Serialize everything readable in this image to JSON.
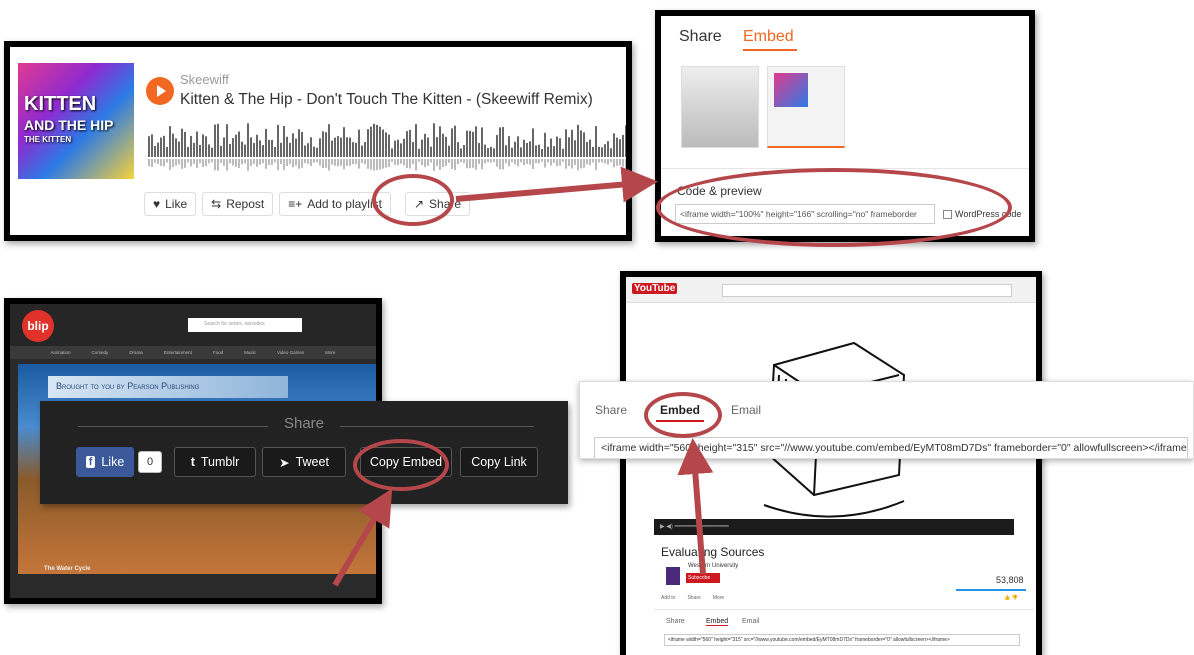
{
  "soundcloud": {
    "art_lines": [
      "KITTEN",
      "AND THE HIP",
      "THE KITTEN"
    ],
    "artist": "Skeewiff",
    "title": "Kitten & The Hip - Don't Touch The Kitten - (Skeewiff Remix)",
    "buttons": {
      "like": "Like",
      "repost": "Repost",
      "add_to_playlist": "Add to playlist",
      "share": "Share"
    },
    "accent": "#f26722"
  },
  "soundcloud_embed": {
    "tabs": [
      "Share",
      "Embed"
    ],
    "code_label": "Code & preview",
    "code_value": "<iframe width=\"100%\" height=\"166\" scrolling=\"no\" frameborder",
    "wordpress_label": "WordPress code"
  },
  "blip": {
    "logo": "blip",
    "search_placeholder": "Search for series, episodes",
    "nav": [
      "Animation",
      "Comedy",
      "Drama",
      "Entertainment",
      "Food",
      "Music",
      "Video Games",
      "More"
    ],
    "banner": "Brought to you by Pearson Publishing",
    "video_title": "The Water Cycle",
    "share_title": "Share",
    "buttons": {
      "like": "Like",
      "like_count": "0",
      "tumblr": "Tumblr",
      "tweet": "Tweet",
      "copy_embed": "Copy Embed",
      "copy_link": "Copy Link"
    }
  },
  "youtube": {
    "logo": "YouTube",
    "video_title": "Evaluating Sources",
    "channel": "Western University",
    "subscribe": "Subscribe",
    "views": "53,808",
    "add_to": "Add to",
    "share": "Share",
    "more": "More",
    "mini_tabs": [
      "Share",
      "Embed",
      "Email"
    ],
    "mini_code": "<iframe width=\"560\" height=\"315\" src=\"//www.youtube.com/embed/EyMT08mD7Ds\" frameborder=\"0\" allowfullscreen></iframe>",
    "embed_tabs": [
      "Share",
      "Embed",
      "Email"
    ],
    "embed_code": "<iframe width=\"560\" height=\"315\" src=\"//www.youtube.com/embed/EyMT08mD7Ds\" frameborder=\"0\" allowfullscreen></iframe>",
    "accent": "#cc181e"
  },
  "annotation_color": "#b5474b"
}
